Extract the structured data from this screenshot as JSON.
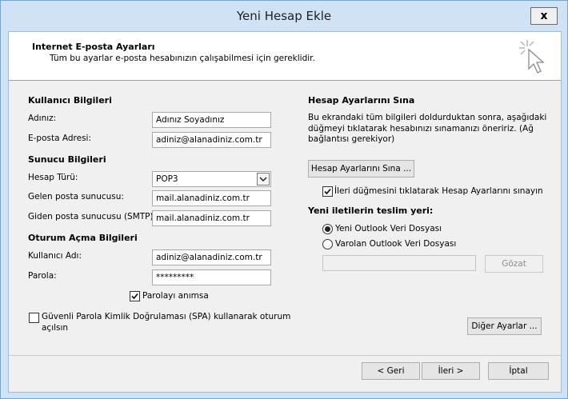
{
  "window": {
    "title": "Yeni Hesap Ekle",
    "close_glyph": "x"
  },
  "header": {
    "title": "Internet E-posta Ayarları",
    "subtitle": "Tüm bu ayarlar e-posta hesabınızın çalışabilmesi için gereklidir.",
    "icon": "wizard-cursor-icon"
  },
  "user_info": {
    "heading": "Kullanıcı Bilgileri",
    "name_label": "Adınız:",
    "name_value": "Adınız Soyadınız",
    "email_label": "E-posta Adresi:",
    "email_value": "adiniz@alanadiniz.com.tr"
  },
  "server_info": {
    "heading": "Sunucu Bilgileri",
    "account_type_label": "Hesap Türü:",
    "account_type_value": "POP3",
    "incoming_label": "Gelen posta sunucusu:",
    "incoming_value": "mail.alanadiniz.com.tr",
    "outgoing_label": "Giden posta sunucusu (SMTP):",
    "outgoing_value": "mail.alanadiniz.com.tr"
  },
  "logon_info": {
    "heading": "Oturum Açma Bilgileri",
    "username_label": "Kullanıcı Adı:",
    "username_value": "adiniz@alanadiniz.com.tr",
    "password_label": "Parola:",
    "password_value": "*********",
    "remember_label": "Parolayı anımsa",
    "remember_checked": true,
    "spa_label_line1": "Güvenli Parola Kimlik Doğrulaması (SPA) kullanarak oturum",
    "spa_label_line2": "açılsın",
    "spa_checked": false
  },
  "test_settings": {
    "heading": "Hesap Ayarlarını Sına",
    "desc_line1": "Bu ekrandaki tüm bilgileri doldurduktan sonra, aşağıdaki",
    "desc_line2": "düğmeyi tıklatarak hesabınızı sınamanızı öneririz. (Ağ",
    "desc_line3": "bağlantısı gerekiyor)",
    "test_button": "Hesap Ayarlarını Sına ...",
    "auto_test_label": "İleri düğmesini tıklatarak Hesap Ayarlarını sınayın",
    "auto_test_checked": true
  },
  "delivery": {
    "heading": "Yeni iletilerin teslim yeri:",
    "option_new": "Yeni Outlook Veri Dosyası",
    "option_existing": "Varolan Outlook Veri Dosyası",
    "selected": "new",
    "file_path_value": "",
    "browse_button": "Gözat"
  },
  "more_settings_button": "Diğer Ayarlar ...",
  "footer": {
    "back_button": "< Geri",
    "next_button": "İleri >",
    "cancel_button": "İptal"
  }
}
